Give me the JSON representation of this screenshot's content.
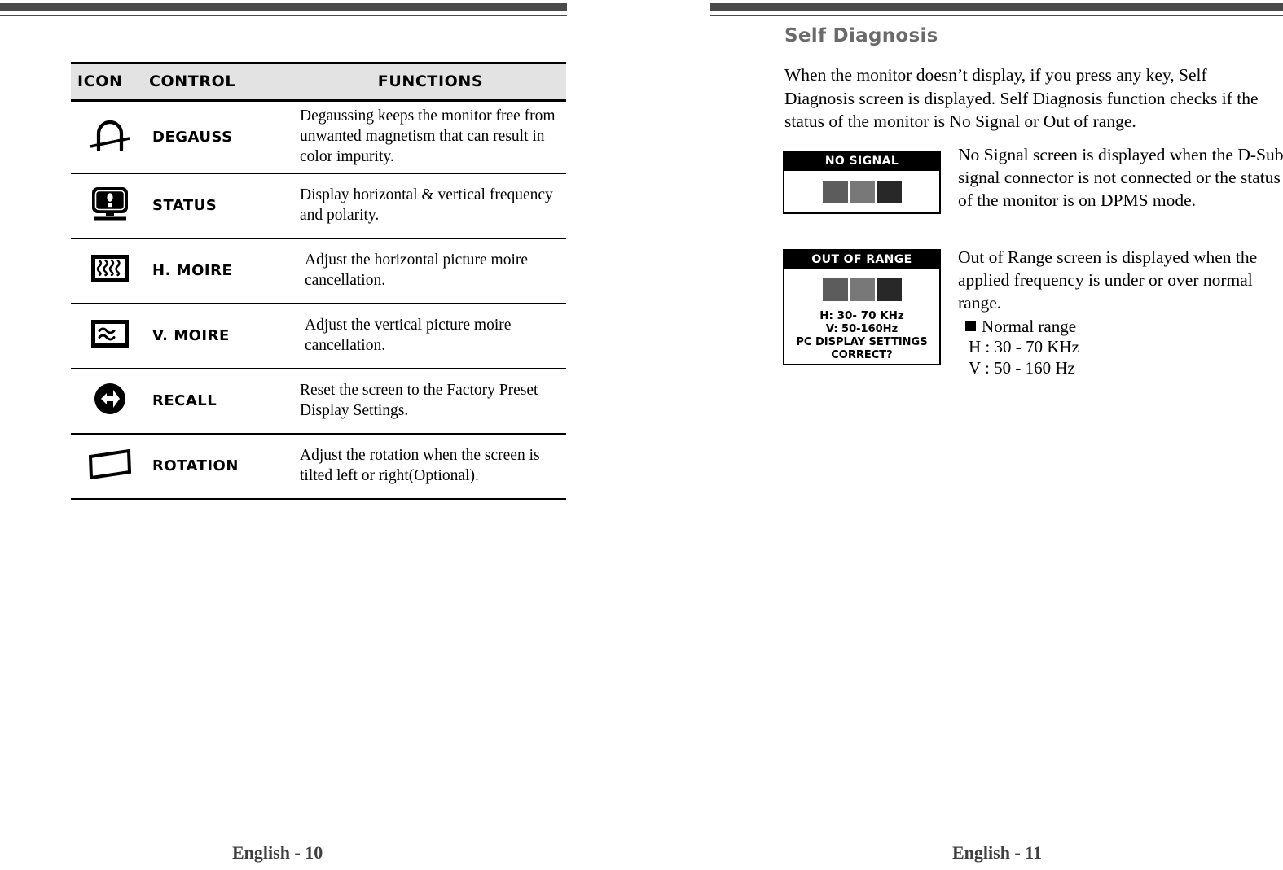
{
  "document": {
    "type": "monitor-user-manual-spread"
  },
  "left_page": {
    "footer": "English - 10",
    "table": {
      "headers": {
        "icon": "ICON",
        "control": "CONTROL",
        "functions": "FUNCTIONS"
      },
      "rows": [
        {
          "icon_name": "degauss-icon",
          "control": "DEGAUSS",
          "function": "Degaussing keeps the monitor free from unwanted magnetism that can result in color impurity."
        },
        {
          "icon_name": "status-monitor-icon",
          "control": "STATUS",
          "function": "Display horizontal & vertical frequency and polarity."
        },
        {
          "icon_name": "h-moire-icon",
          "control": "H. MOIRE",
          "function": "Adjust the horizontal picture moire cancellation."
        },
        {
          "icon_name": "v-moire-icon",
          "control": "V. MOIRE",
          "function": "Adjust the vertical picture moire cancellation."
        },
        {
          "icon_name": "recall-icon",
          "control": "RECALL",
          "function": "Reset the screen to the Factory Preset Display Settings."
        },
        {
          "icon_name": "rotation-icon",
          "control": "ROTATION",
          "function": "Adjust the rotation when the screen is tilted left or right(Optional)."
        }
      ]
    }
  },
  "right_page": {
    "footer": "English - 11",
    "section_title": "Self Diagnosis",
    "intro": "When the monitor doesn’t  display, if you press any key, Self Diagnosis screen is displayed.  Self Diagnosis function checks if the status of the monitor is No Signal or Out of range.",
    "no_signal": {
      "osd_title": "NO SIGNAL",
      "description": "No Signal screen is displayed when the D-Sub signal connector is not connected or the status of the monitor is on DPMS mode."
    },
    "out_of_range": {
      "osd_title": "OUT OF RANGE",
      "osd_line_h": "H: 30- 70 KHz",
      "osd_line_v": "V: 50-160Hz",
      "osd_line_prompt1": "PC DISPLAY SETTINGS",
      "osd_line_prompt2": "CORRECT?",
      "description": "Out of Range screen is displayed when the applied frequency is under or over normal range."
    },
    "normal_range": {
      "heading": "Normal range",
      "horizontal": "H : 30 - 70 KHz",
      "vertical": "V : 50 - 160 Hz"
    }
  },
  "colors": {
    "rule": "#4a4a4a",
    "header_bg": "#e3e3e3",
    "section_title": "#6a6a6a",
    "bar_dark": "#5c5c5c",
    "bar_mid": "#787878",
    "bar_darkest": "#282828"
  }
}
